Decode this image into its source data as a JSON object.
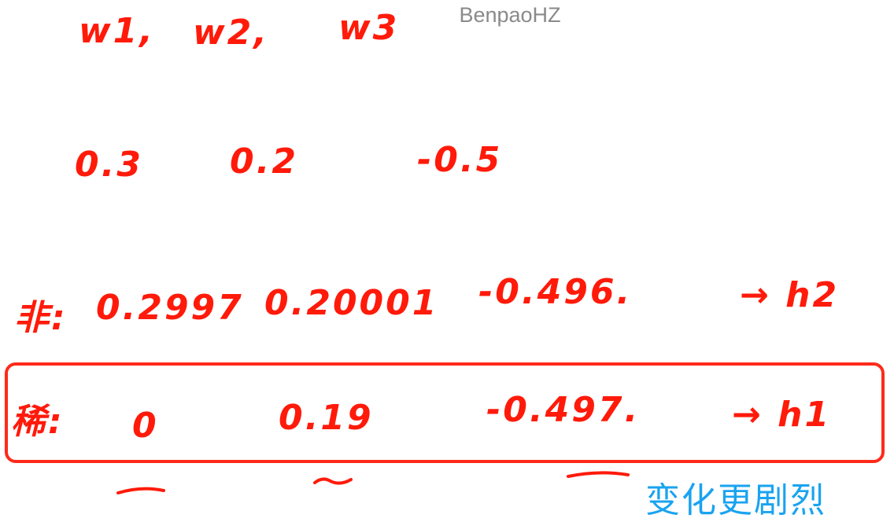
{
  "watermark": "BenpaoHZ",
  "weights": {
    "labels": [
      "w1,",
      "w2,",
      "w3"
    ],
    "values": [
      "0.3",
      "0.2",
      "-0.5"
    ]
  },
  "rows": [
    {
      "label": "非:",
      "values": [
        "0.2997",
        "0.20001",
        "-0.496."
      ],
      "result": "→ h2"
    },
    {
      "label": "稀:",
      "values": [
        "0",
        "0.19",
        "-0.497."
      ],
      "result": "→ h1"
    }
  ],
  "caption": "变化更剧烈",
  "colors": {
    "ink": "#ff1a0a",
    "caption": "#1aa3f0",
    "watermark": "#8a8a8a"
  }
}
